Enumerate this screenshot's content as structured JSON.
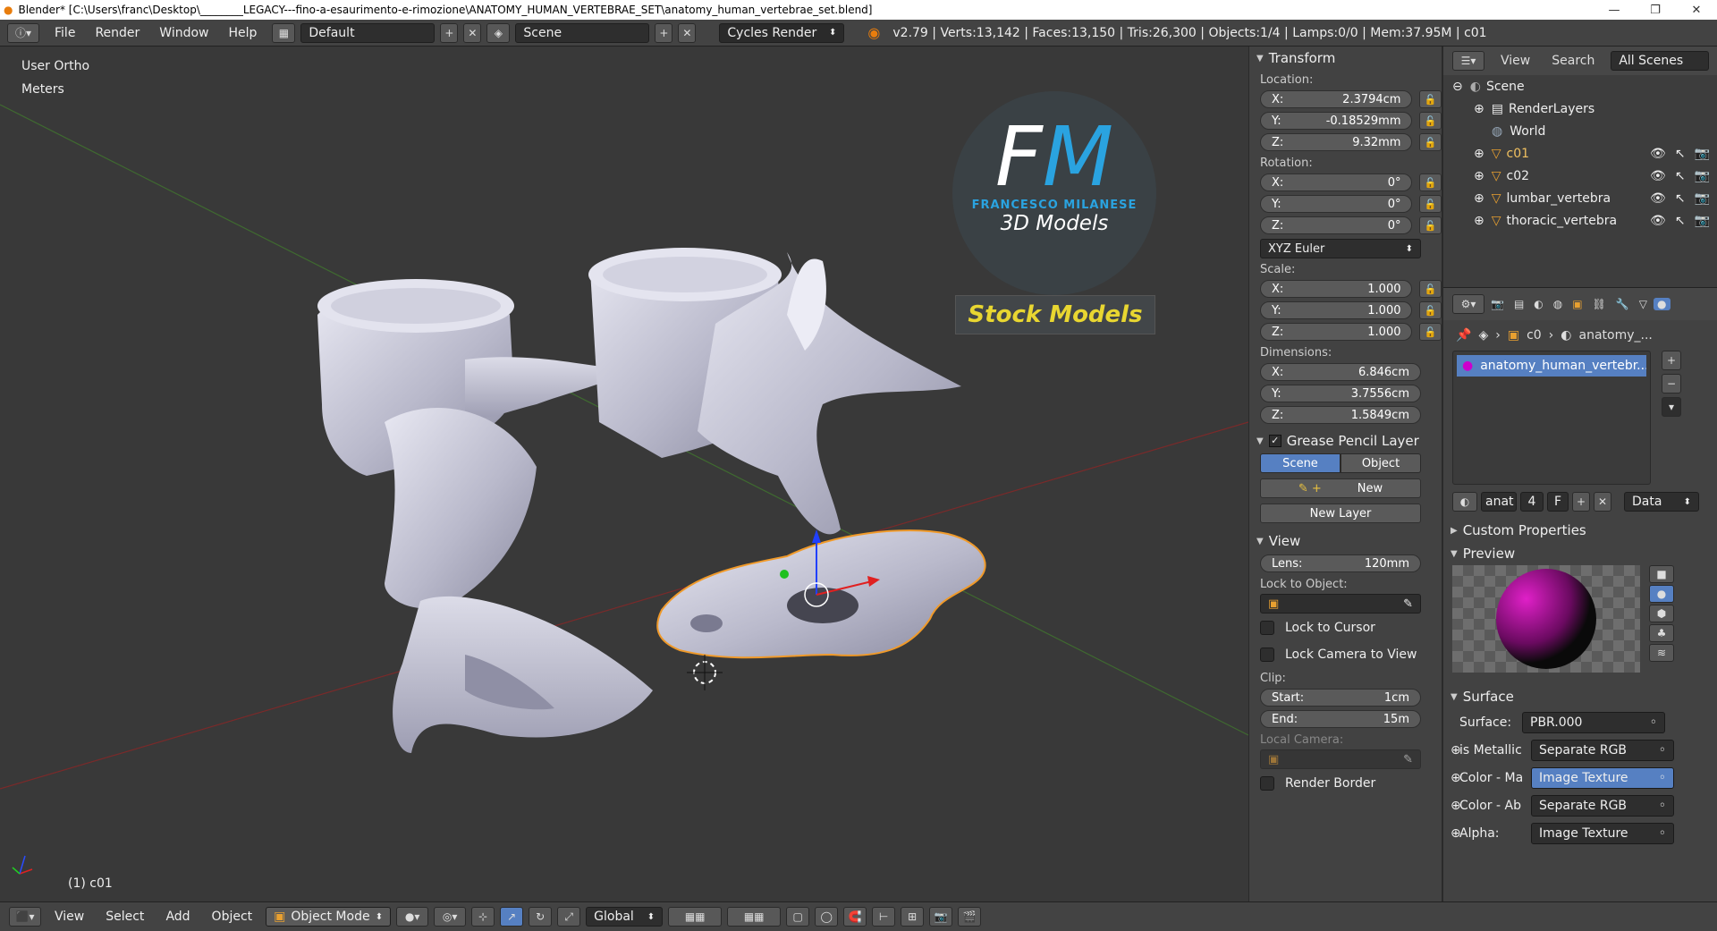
{
  "titlebar": {
    "title": "Blender* [C:\\Users\\franc\\Desktop\\________LEGACY---fino-a-esaurimento-e-rimozione\\ANATOMY_HUMAN_VERTEBRAE_SET\\anatomy_human_vertebrae_set.blend]",
    "minimize": "—",
    "maximize": "❐",
    "close": "✕"
  },
  "infobar": {
    "menus": [
      "File",
      "Render",
      "Window",
      "Help"
    ],
    "screen_layout": "Default",
    "scene": "Scene",
    "render_engine": "Cycles Render",
    "stats": "v2.79 | Verts:13,142 | Faces:13,150 | Tris:26,300 | Objects:1/4 | Lamps:0/0 | Mem:37.95M | c01"
  },
  "viewport": {
    "view_name": "User Ortho",
    "units": "Meters",
    "object_info": "(1) c01",
    "logo": {
      "letters_f": "F",
      "letters_m": "M",
      "name": "FRANCESCO MILANESE",
      "subtitle": "3D Models",
      "banner": "Stock Models"
    }
  },
  "transform": {
    "header": "Transform",
    "location_label": "Location:",
    "location": [
      {
        "axis": "X:",
        "value": "2.3794cm"
      },
      {
        "axis": "Y:",
        "value": "-0.18529mm"
      },
      {
        "axis": "Z:",
        "value": "9.32mm"
      }
    ],
    "rotation_label": "Rotation:",
    "rotation": [
      {
        "axis": "X:",
        "value": "0°"
      },
      {
        "axis": "Y:",
        "value": "0°"
      },
      {
        "axis": "Z:",
        "value": "0°"
      }
    ],
    "rotation_mode": "XYZ Euler",
    "scale_label": "Scale:",
    "scale": [
      {
        "axis": "X:",
        "value": "1.000"
      },
      {
        "axis": "Y:",
        "value": "1.000"
      },
      {
        "axis": "Z:",
        "value": "1.000"
      }
    ],
    "dimensions_label": "Dimensions:",
    "dimensions": [
      {
        "axis": "X:",
        "value": "6.846cm"
      },
      {
        "axis": "Y:",
        "value": "3.7556cm"
      },
      {
        "axis": "Z:",
        "value": "1.5849cm"
      }
    ]
  },
  "grease_pencil": {
    "header": "Grease Pencil Layer",
    "tab_scene": "Scene",
    "tab_object": "Object",
    "new_label": "New",
    "new_layer_label": "New Layer"
  },
  "view_panel": {
    "header": "View",
    "lens_label": "Lens:",
    "lens_value": "120mm",
    "lock_object_label": "Lock to Object:",
    "lock_cursor": "Lock to Cursor",
    "lock_camera": "Lock Camera to View",
    "clip_label": "Clip:",
    "clip_start_label": "Start:",
    "clip_start": "1cm",
    "clip_end_label": "End:",
    "clip_end": "15m",
    "local_camera": "Local Camera:",
    "render_border": "Render Border"
  },
  "outliner": {
    "menu_view": "View",
    "menu_search": "Search",
    "filter": "All Scenes",
    "items": [
      {
        "name": "Scene"
      },
      {
        "name": "RenderLayers"
      },
      {
        "name": "World"
      },
      {
        "name": "c01"
      },
      {
        "name": "c02"
      },
      {
        "name": "lumbar_vertebra"
      },
      {
        "name": "thoracic_vertebra"
      }
    ]
  },
  "properties": {
    "breadcrumb_object": "c0",
    "breadcrumb_material": "anatomy_...",
    "material_slot": "anatomy_human_vertebr...",
    "mat_name_short": "anat",
    "users": "4",
    "fake_user": "F",
    "link": "Data",
    "custom_properties": "Custom Properties",
    "preview": "Preview",
    "surface_header": "Surface",
    "surface_label": "Surface:",
    "surface_value": "PBR.000",
    "inputs": [
      {
        "label": "is Metallic",
        "value": "Separate RGB",
        "highlight": false
      },
      {
        "label": "Color - Ma",
        "value": "Image Texture",
        "highlight": true
      },
      {
        "label": "Color - Ab",
        "value": "Separate RGB",
        "highlight": false
      },
      {
        "label": "Alpha:",
        "value": "Image Texture",
        "highlight": false
      }
    ]
  },
  "statusbar": {
    "menus": [
      "View",
      "Select",
      "Add",
      "Object"
    ],
    "mode": "Object Mode",
    "orientation": "Global"
  },
  "colors": {
    "accent_blue": "#5680c2",
    "logo_cyan": "#2aa3e0",
    "banner_yellow": "#e8d631",
    "selection_orange": "#f09a2a"
  }
}
